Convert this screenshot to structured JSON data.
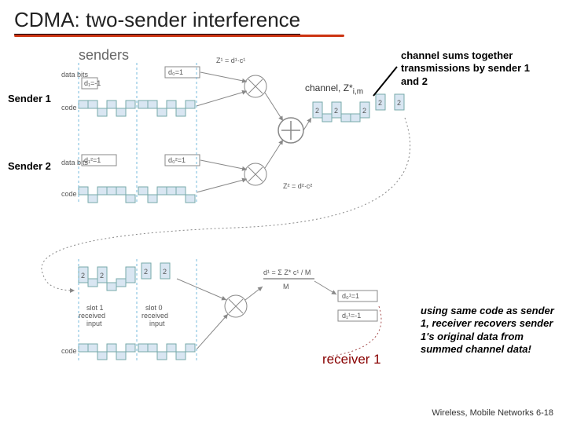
{
  "title": "CDMA: two-sender interference",
  "labels": {
    "senders": "senders",
    "sender1": "Sender 1",
    "sender2": "Sender 2",
    "receiver1": "receiver 1",
    "channel": "channel, Z*",
    "channel_sub": "i,m"
  },
  "annotations": {
    "channel_sum": "channel sums together transmissions by sender 1 and 2",
    "receiver_note": "using same code as sender 1, receiver recovers sender 1's original data from summed channel data!"
  },
  "small_text": {
    "data_bits": "data bits",
    "code": "code",
    "slot1_received": "slot 1 received input",
    "slot0_received": "slot 0 received input",
    "d0_eq_1": "d₀=1",
    "d1_eq_neg1": "d₁=-1",
    "z1": "Z¹ = d¹·c¹",
    "z2": "Z² = d²·c²",
    "d1_formula": "d¹ = Σ Z* c¹ / M"
  },
  "footer": "Wireless, Mobile Networks  6-18"
}
